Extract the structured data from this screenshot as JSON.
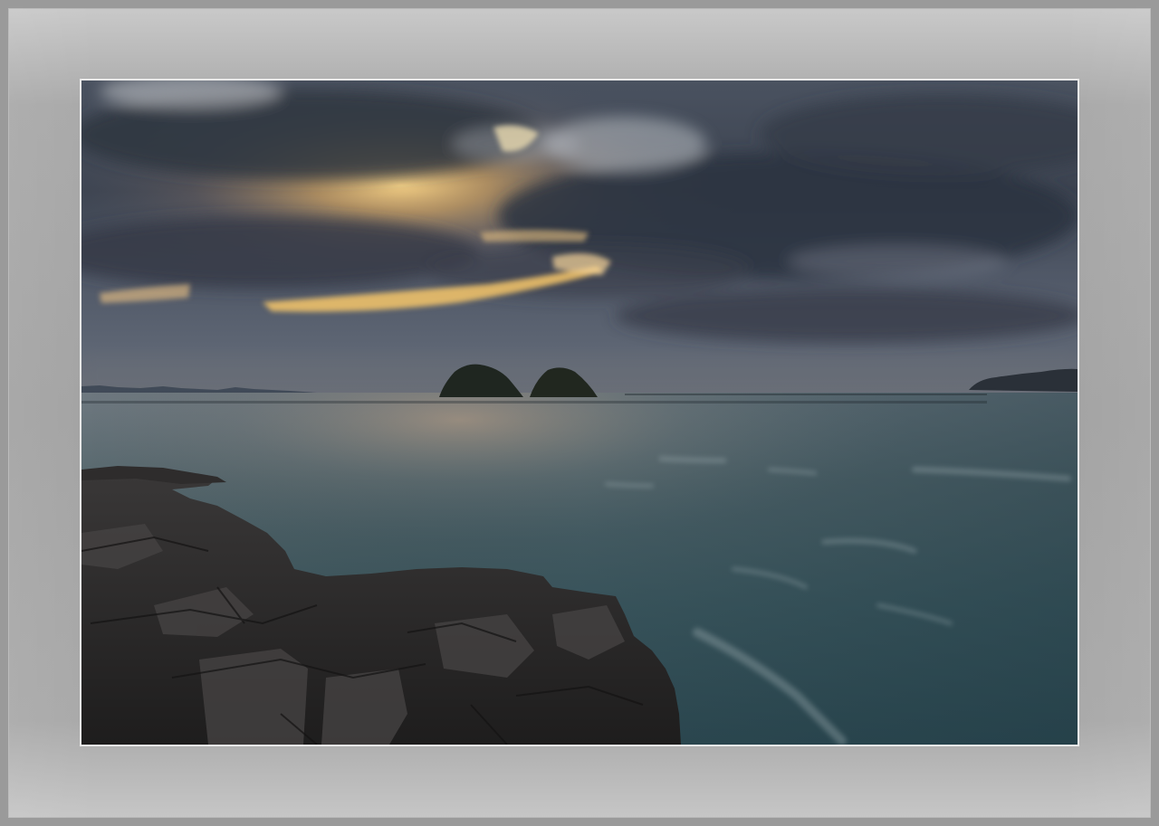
{
  "scene": {
    "subject": "seascape",
    "colors": {
      "mat": "#a5a5a5",
      "frame_edge": "#8a8a8a",
      "photo_border": "#e8e8e8",
      "sky_dark": "#3d4552",
      "sky_mid": "#5b6473",
      "sunset_glow": "#f3c66b",
      "sea": "#3e5a62",
      "rock": "#2b2a2a"
    }
  }
}
